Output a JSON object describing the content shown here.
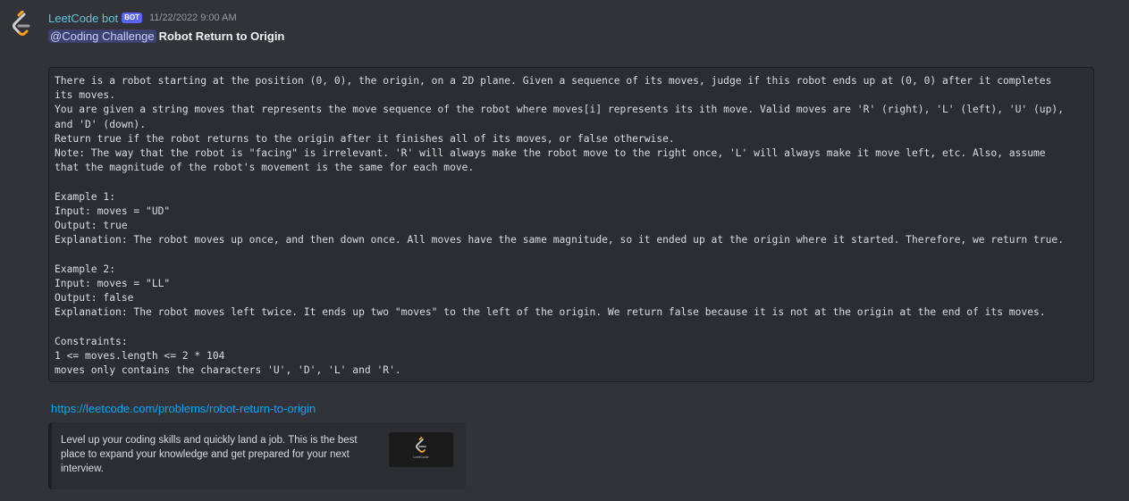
{
  "message": {
    "author": "LeetCode bot",
    "badge": "BOT",
    "timestamp": "11/22/2022 9:00 AM",
    "mention": "@Coding Challenge",
    "title": "Robot Return to Origin",
    "code_content": "There is a robot starting at the position (0, 0), the origin, on a 2D plane. Given a sequence of its moves, judge if this robot ends up at (0, 0) after it completes\nits moves.\nYou are given a string moves that represents the move sequence of the robot where moves[i] represents its ith move. Valid moves are 'R' (right), 'L' (left), 'U' (up),\nand 'D' (down).\nReturn true if the robot returns to the origin after it finishes all of its moves, or false otherwise.\nNote: The way that the robot is \"facing\" is irrelevant. 'R' will always make the robot move to the right once, 'L' will always make it move left, etc. Also, assume\nthat the magnitude of the robot's movement is the same for each move.\n\nExample 1:\nInput: moves = \"UD\"\nOutput: true\nExplanation: The robot moves up once, and then down once. All moves have the same magnitude, so it ended up at the origin where it started. Therefore, we return true.\n\nExample 2:\nInput: moves = \"LL\"\nOutput: false\nExplanation: The robot moves left twice. It ends up two \"moves\" to the left of the origin. We return false because it is not at the origin at the end of its moves.\n\nConstraints:\n1 <= moves.length <= 2 * 104\nmoves only contains the characters 'U', 'D', 'L' and 'R'.",
    "link": "https://leetcode.com/problems/robot-return-to-origin",
    "embed": {
      "description": "Level up your coding skills and quickly land a job. This is the best place to expand your knowledge and get prepared for your next interview.",
      "thumbnail_label": "LeetCode"
    }
  },
  "colors": {
    "background": "#313338",
    "username": "#64c3e0",
    "link": "#00a8fc",
    "badge": "#5865f2",
    "leetcode_orange": "#ffa116"
  },
  "icons": {
    "avatar": "leetcode-logo-icon",
    "thumbnail": "leetcode-logo-icon"
  }
}
